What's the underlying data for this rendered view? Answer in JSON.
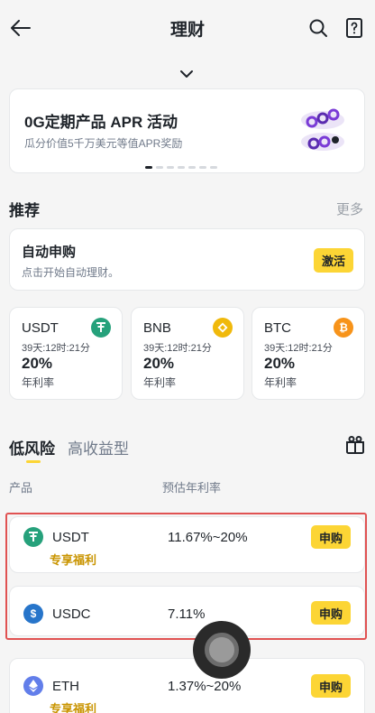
{
  "header": {
    "title": "理财"
  },
  "banner": {
    "title": "0G定期产品 APR 活动",
    "subtitle": "瓜分价值5千万美元等值APR奖励"
  },
  "recommend": {
    "title": "推荐",
    "more": "更多"
  },
  "auto_subscribe": {
    "title": "自动申购",
    "subtitle": "点击开始自动理财。",
    "button": "激活"
  },
  "coins": [
    {
      "name": "USDT",
      "time": "39天:12时:21分",
      "rate": "20%",
      "label": "年利率",
      "color": "#26a17b"
    },
    {
      "name": "BNB",
      "time": "39天:12时:21分",
      "rate": "20%",
      "label": "年利率",
      "color": "#f0b90b"
    },
    {
      "name": "BTC",
      "time": "39天:12时:21分",
      "rate": "20%",
      "label": "年利率",
      "color": "#f7931a"
    }
  ],
  "tabs": [
    {
      "label": "低风险"
    },
    {
      "label": "高收益型"
    }
  ],
  "columns": {
    "product": "产品",
    "apr": "预估年利率"
  },
  "products": [
    {
      "name": "USDT",
      "tag": "专享福利",
      "rate": "11.67%~20%",
      "button": "申购",
      "color": "#26a17b"
    },
    {
      "name": "USDC",
      "tag": "",
      "rate": "7.11%",
      "button": "申购",
      "color": "#2775ca"
    },
    {
      "name": "ETH",
      "tag": "专享福利",
      "rate": "1.37%~20%",
      "button": "申购",
      "color": "#627eea"
    }
  ]
}
